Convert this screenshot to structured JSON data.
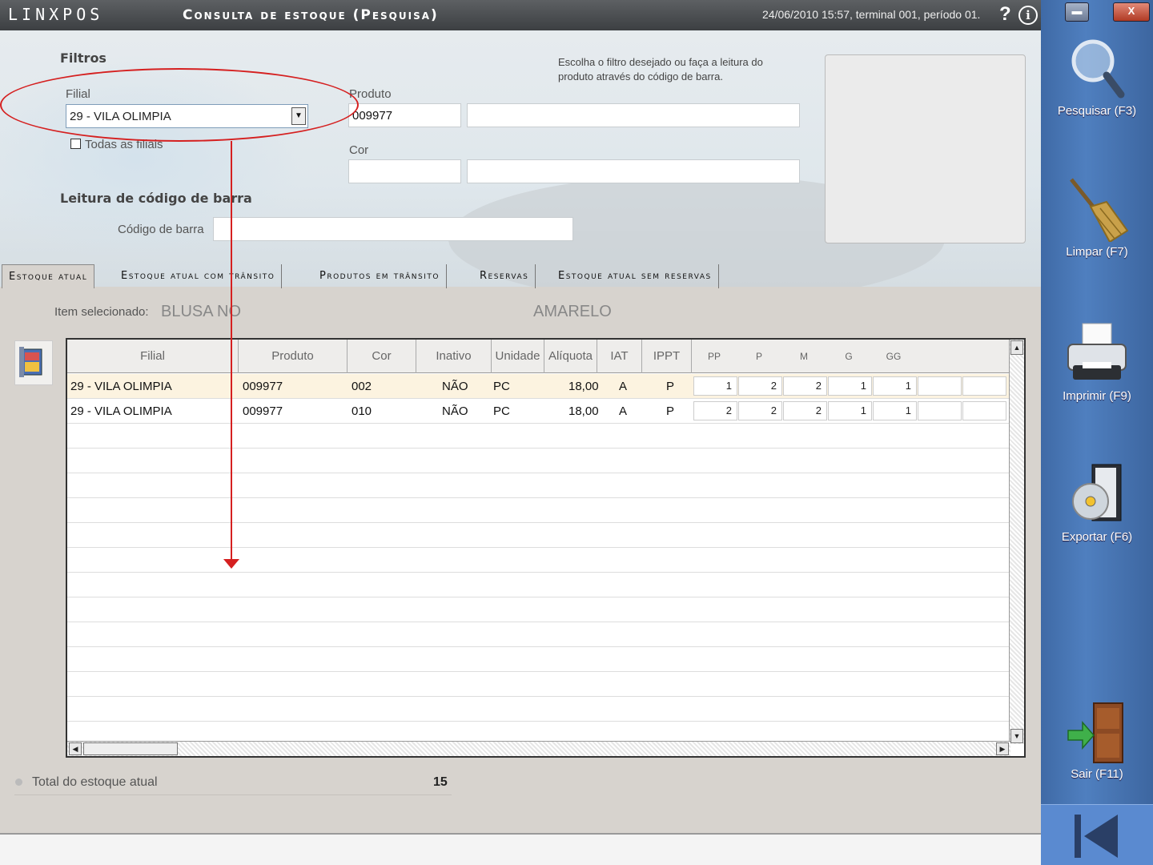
{
  "titlebar": {
    "app_name": "LINXPOS",
    "window_title": "Consulta de estoque (Pesquisa)",
    "session_info": "24/06/2010 15:57, terminal 001, período 01.",
    "help_glyph": "?",
    "info_glyph": "i"
  },
  "window_controls": {
    "minimize": "▬",
    "close": "X"
  },
  "side_actions": [
    {
      "label": "Pesquisar (F3)",
      "icon": "magnifier-icon"
    },
    {
      "label": "Limpar (F7)",
      "icon": "broom-icon"
    },
    {
      "label": "Imprimir (F9)",
      "icon": "printer-icon"
    },
    {
      "label": "Exportar (F6)",
      "icon": "disc-export-icon"
    },
    {
      "label": "Sair (F11)",
      "icon": "door-exit-icon"
    }
  ],
  "filters": {
    "section_title": "Filtros",
    "filial_label": "Filial",
    "filial_value": "29 - VILA OLIMPIA",
    "todas_label": "Todas as filiais",
    "produto_label": "Produto",
    "produto_code": "009977",
    "produto_desc": "",
    "cor_label": "Cor",
    "cor_code": "",
    "cor_desc": "",
    "hint": "Escolha o filtro desejado ou faça a leitura do produto através do código de barra.",
    "barcode_section": "Leitura de código de barra",
    "barcode_label": "Código de barra",
    "barcode_value": ""
  },
  "tabs": [
    {
      "label": "Estoque atual",
      "active": true
    },
    {
      "label": "Estoque atual com trânsito"
    },
    {
      "label": "Produtos em trânsito"
    },
    {
      "label": "Reservas"
    },
    {
      "label": "Estoque atual sem reservas"
    }
  ],
  "selected_item": {
    "label": "Item selecionado:",
    "name": "BLUSA NO",
    "color": "AMARELO"
  },
  "grid": {
    "columns": [
      "Filial",
      "Produto",
      "Cor",
      "Inativo",
      "Unidade",
      "Alíquota",
      "IAT",
      "IPPT"
    ],
    "sizes": [
      "PP",
      "P",
      "M",
      "G",
      "GG"
    ],
    "rows": [
      {
        "filial": "29 - VILA OLIMPIA",
        "produto": "009977",
        "cor": "002",
        "inativo": "NÃO",
        "unidade": "PC",
        "aliquota": "18,00",
        "iat": "A",
        "ippt": "P",
        "qty": [
          "1",
          "2",
          "2",
          "1",
          "1"
        ]
      },
      {
        "filial": "29 - VILA OLIMPIA",
        "produto": "009977",
        "cor": "010",
        "inativo": "NÃO",
        "unidade": "PC",
        "aliquota": "18,00",
        "iat": "A",
        "ippt": "P",
        "qty": [
          "2",
          "2",
          "2",
          "1",
          "1"
        ]
      }
    ]
  },
  "total": {
    "label": "Total do estoque atual",
    "value": "15"
  },
  "colors": {
    "accent_panel": "#4a78b8",
    "annotation": "#d52020",
    "selected_row": "#fcf3e0"
  }
}
